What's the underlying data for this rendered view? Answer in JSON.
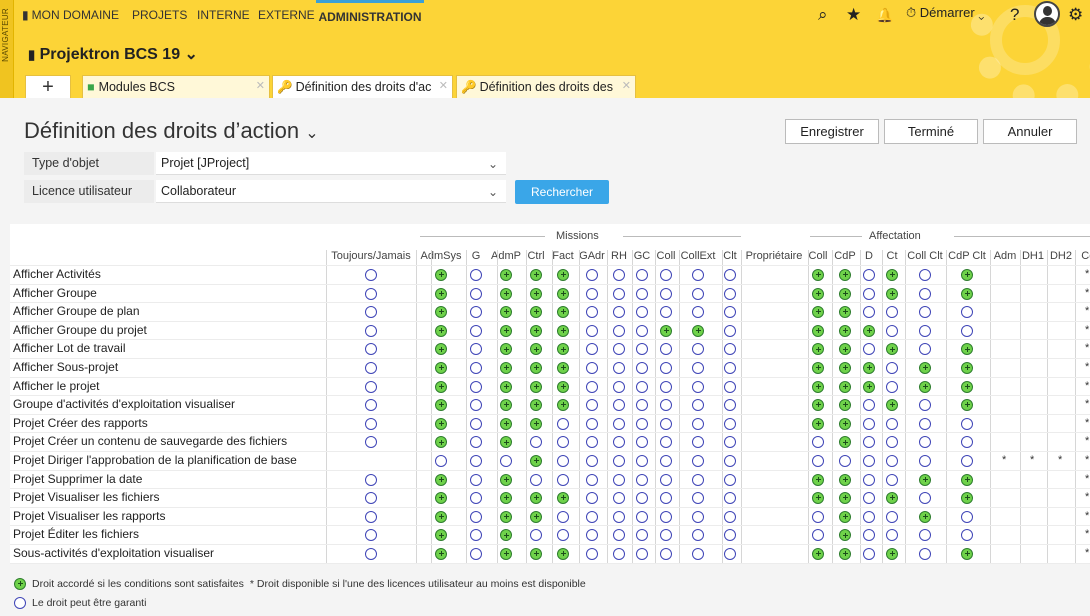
{
  "nav": {
    "navigator_label": "NAVIGATEUR",
    "menu": [
      "MON DOMAINE",
      "PROJETS",
      "INTERNE",
      "EXTERNE",
      "ADMINISTRATION"
    ],
    "active_menu": "ADMINISTRATION",
    "start_label": "Démarrer"
  },
  "project": {
    "name": "Projektron BCS 19"
  },
  "tabs": [
    {
      "label": "Modules BCS"
    },
    {
      "label": "Définition des droits d'ac"
    },
    {
      "label": "Définition des droits des"
    }
  ],
  "page": {
    "title": "Définition des droits d’action",
    "buttons": {
      "save": "Enregistrer",
      "done": "Terminé",
      "cancel": "Annuler"
    }
  },
  "filters": {
    "object_type_label": "Type d'objet",
    "object_type_value": "Projet [JProject]",
    "license_label": "Licence utilisateur",
    "license_value": "Collaborateur",
    "search_label": "Rechercher"
  },
  "grid": {
    "group_missions": "Missions",
    "group_affectation": "Affectation",
    "columns": [
      "Toujours/Jamais",
      "AdmSys",
      "G",
      "AdmP",
      "Ctrl",
      "Fact",
      "GAdr",
      "RH",
      "GC",
      "Coll",
      "CollExt",
      "Clt",
      "Propriétaire",
      "Coll",
      "CdP",
      "D",
      "Ct",
      "Coll Clt",
      "CdP Clt",
      "Adm",
      "DH1",
      "DH2",
      "Cc"
    ],
    "rows": [
      {
        "label": "Afficher Activités",
        "cells": "bgbgggbbbbbb-ggbgbg---*"
      },
      {
        "label": "Afficher Groupe",
        "cells": "bgbgggbbbbbb-ggbgbg---*"
      },
      {
        "label": "Afficher Groupe de plan",
        "cells": "bgbgggbbbbbb-ggbbbb---*"
      },
      {
        "label": "Afficher Groupe du projet",
        "cells": "bgbgggbbbggb-gggbbb---*"
      },
      {
        "label": "Afficher Lot de travail",
        "cells": "bgbgggbbbbbb-ggbgbg---*"
      },
      {
        "label": "Afficher Sous-projet",
        "cells": "bgbgggbbbbbb-gggbgg---*"
      },
      {
        "label": "Afficher le projet",
        "cells": "bgbgggbbbbbb-gggbgg---*"
      },
      {
        "label": "Groupe d'activités d'exploitation visualiser",
        "cells": "bgbgggbbbbbb-ggbgbg---*"
      },
      {
        "label": "Projet Créer des rapports",
        "cells": "bgbggbbbbbbb-ggbbbb---*"
      },
      {
        "label": "Projet Créer un contenu de sauvegarde des fichiers",
        "cells": "bgbgbbbbbbbb-bgbbbb---*"
      },
      {
        "label": "Projet Diriger l'approbation de la planification de base",
        "cells": "-bbbgbbbbbbb-bbbbbb****"
      },
      {
        "label": "Projet Supprimer la date",
        "cells": "bgbgbbbbbbbb-ggbbgg---*"
      },
      {
        "label": "Projet Visualiser les fichiers",
        "cells": "bgbgggbbbbbb-ggbgbg---*"
      },
      {
        "label": "Projet Visualiser les rapports",
        "cells": "bgbggbbbbbbb-bgbbgb---*"
      },
      {
        "label": "Projet Éditer les fichiers",
        "cells": "bgbgbbbbbbbb-bgbbbb---*"
      },
      {
        "label": "Sous-activités d'exploitation visualiser",
        "cells": "bgbgggbbbbbb-ggbgbg---*"
      }
    ]
  },
  "legend": {
    "granted": "Droit accordé si les conditions sont satisfaites",
    "star": "* Droit disponible si l'une des licences utilisateur au moins est disponible",
    "can_grant": "Le droit peut être garanti"
  }
}
